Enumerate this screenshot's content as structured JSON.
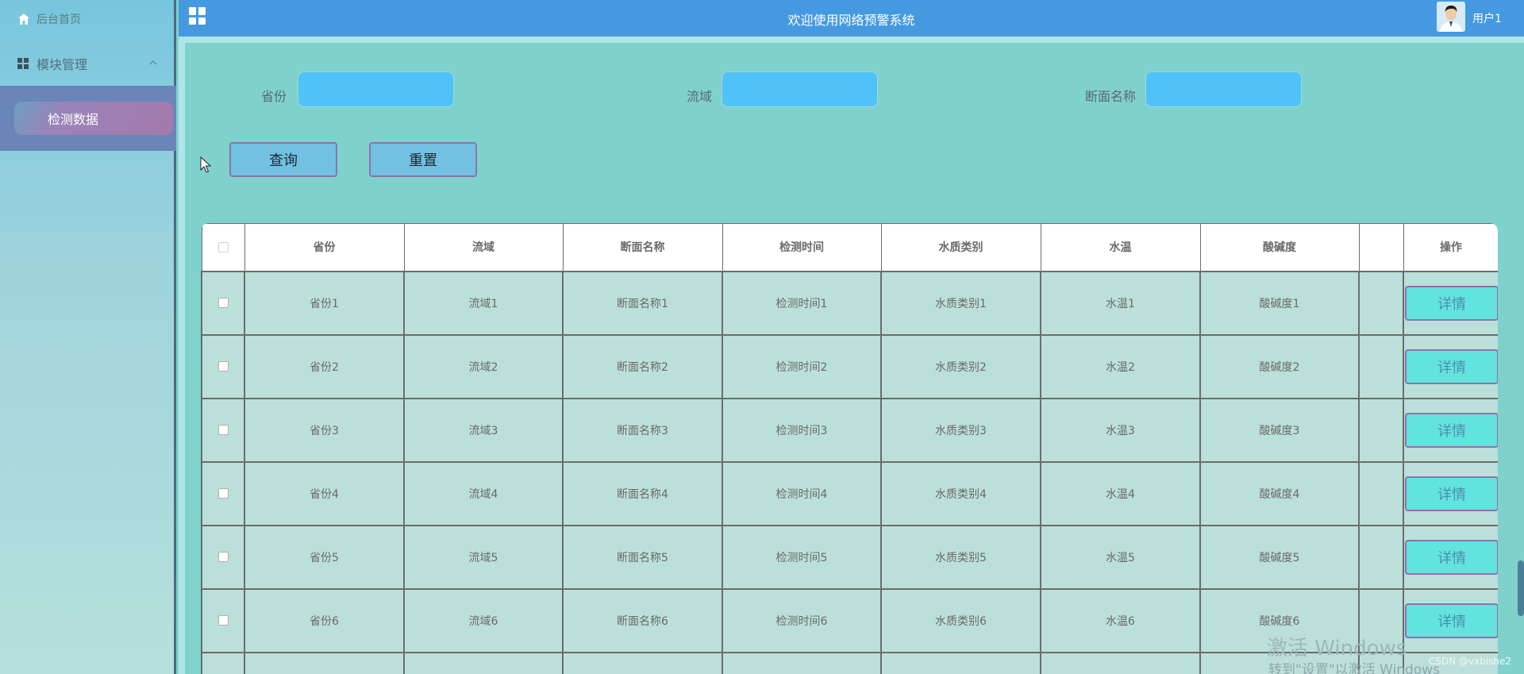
{
  "sidebar": {
    "home_label": "后台首页",
    "module_label": "模块管理",
    "sub_item_label": "检测数据"
  },
  "header": {
    "title": "欢迎使用网络预警系统",
    "user_name": "用户1"
  },
  "filters": {
    "province_label": "省份",
    "basin_label": "流域",
    "section_label": "断面名称"
  },
  "buttons": {
    "query": "查询",
    "reset": "重置"
  },
  "table": {
    "headers": [
      "省份",
      "流域",
      "断面名称",
      "检测时间",
      "水质类别",
      "水温",
      "酸碱度",
      "",
      "操作"
    ],
    "detail_label": "详情",
    "rows": [
      [
        "省份1",
        "流域1",
        "断面名称1",
        "检测时间1",
        "水质类别1",
        "水温1",
        "酸碱度1"
      ],
      [
        "省份2",
        "流域2",
        "断面名称2",
        "检测时间2",
        "水质类别2",
        "水温2",
        "酸碱度2"
      ],
      [
        "省份3",
        "流域3",
        "断面名称3",
        "检测时间3",
        "水质类别3",
        "水温3",
        "酸碱度3"
      ],
      [
        "省份4",
        "流域4",
        "断面名称4",
        "检测时间4",
        "水质类别4",
        "水温4",
        "酸碱度4"
      ],
      [
        "省份5",
        "流域5",
        "断面名称5",
        "检测时间5",
        "水质类别5",
        "水温5",
        "酸碱度5"
      ],
      [
        "省份6",
        "流域6",
        "断面名称6",
        "检测时间6",
        "水质类别6",
        "水温6",
        "酸碱度6"
      ]
    ]
  },
  "overlay": {
    "watermark_line1": "激活 Windows",
    "watermark_line2": "转到\"设置\"以激活 Windows",
    "csdn": "CSDN @vxbishe2"
  },
  "colors": {
    "header_bg": "#4599e0",
    "panel_bg": "#7fd1cc",
    "input_bg": "#4fc2f7",
    "button_bg": "#72c1e3",
    "button_border": "#8d73ac",
    "detail_bg": "#63e3de",
    "sub_menu_bg": "#6a85b8",
    "row_bg": "#bbe0da"
  },
  "icons": [
    "home-icon",
    "grid-icon",
    "chevron-up-icon",
    "menu-grid-icon",
    "avatar",
    "checkbox"
  ]
}
